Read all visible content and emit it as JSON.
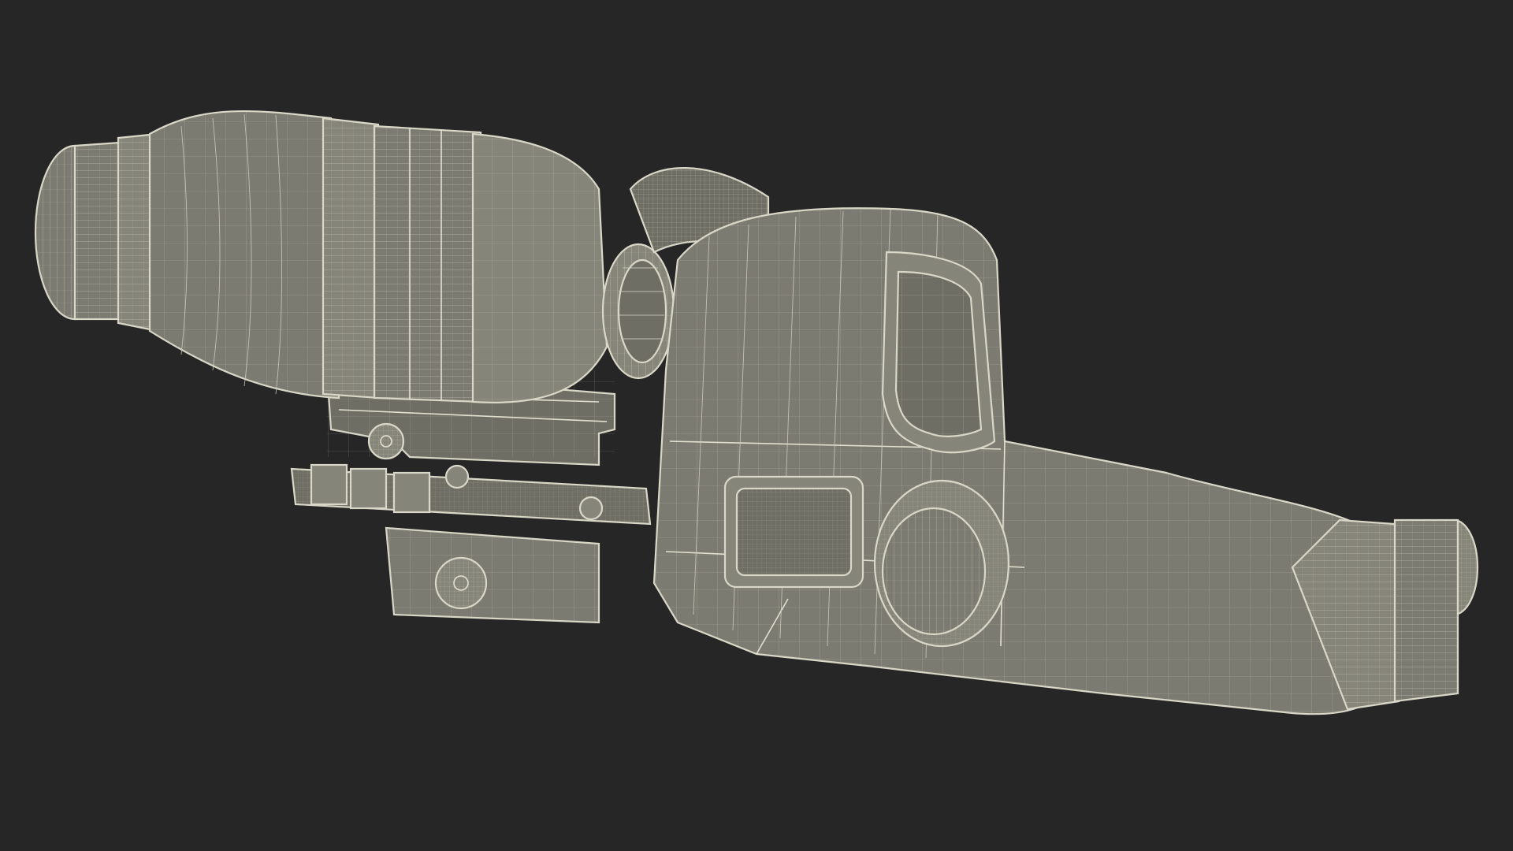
{
  "scene": {
    "subject_icon": "wireframe-holographic-sight-with-magnifier-icon",
    "colors": {
      "background": "#262626",
      "surface": "#7b7b71",
      "wire": "#d9d8c8"
    }
  }
}
